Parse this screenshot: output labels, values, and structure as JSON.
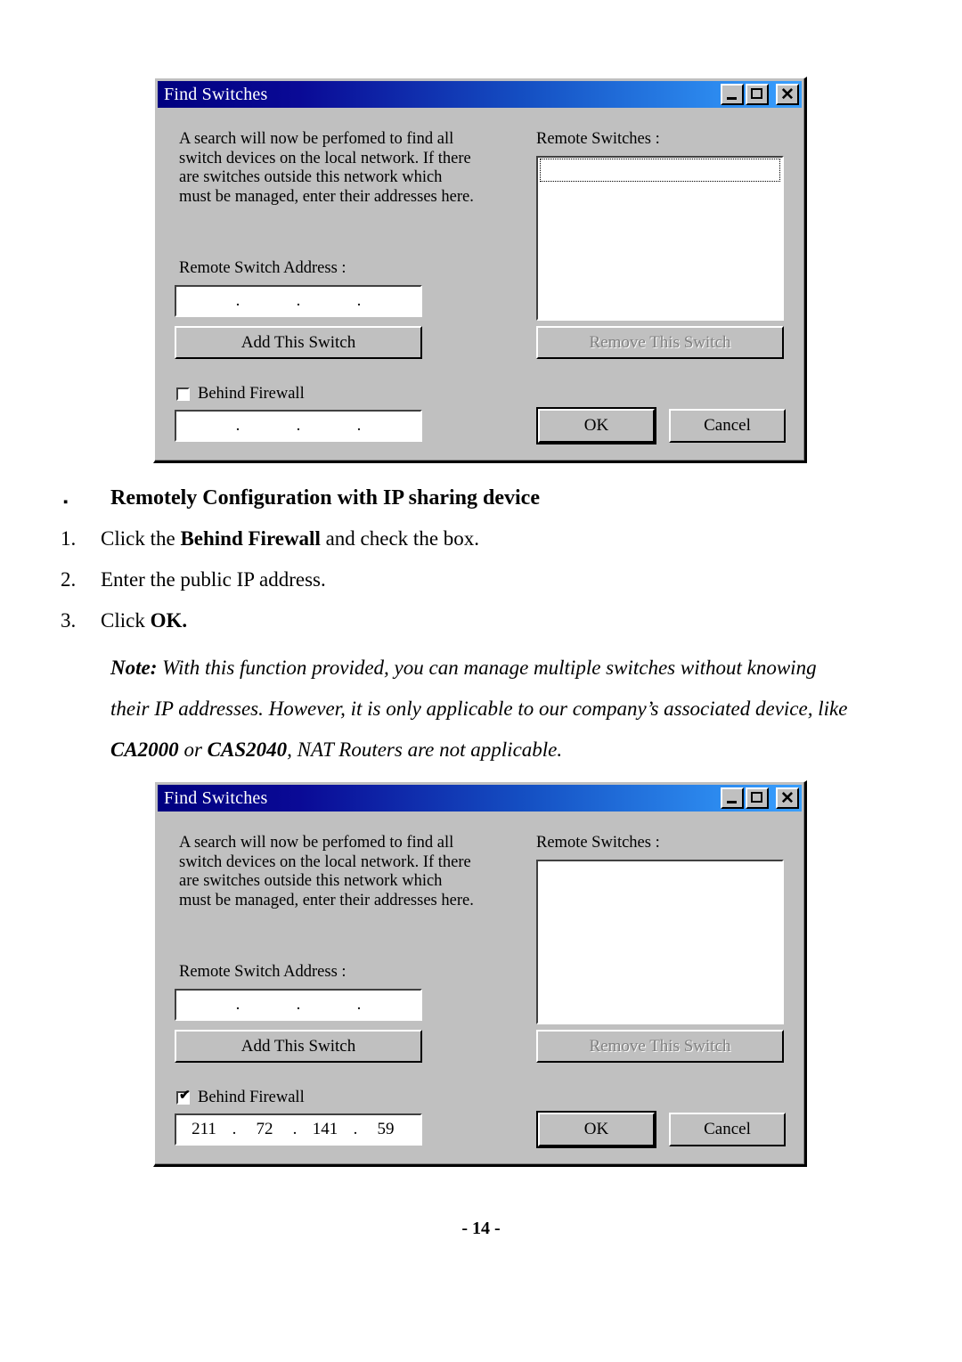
{
  "dialogs": [
    {
      "title": "Find Switches",
      "description": "A search will now be perfomed to find all\nswitch devices on the local network. If there\nare switches outside this network which\nmust be managed, enter their addresses here.",
      "remote_switches_label": "Remote Switches :",
      "remote_switch_address_label": "Remote Switch Address :",
      "address_octets": [
        "",
        "",
        "",
        ""
      ],
      "add_button": "Add This Switch",
      "remove_button": "Remove This Switch",
      "remove_disabled": true,
      "behind_firewall_label": "Behind Firewall",
      "behind_firewall_checked": false,
      "firewall_octets": [
        "",
        "",
        "",
        ""
      ],
      "ok_button": "OK",
      "cancel_button": "Cancel",
      "listbox_items": [],
      "listbox_focus": true,
      "window_controls": {
        "minimize": "minimize-icon",
        "maximize": "maximize-icon",
        "close": "✕"
      }
    },
    {
      "title": "Find Switches",
      "description": "A search will now be perfomed to find all\nswitch devices on the local network. If there\nare switches outside this network which\nmust be managed, enter their addresses here.",
      "remote_switches_label": "Remote Switches :",
      "remote_switch_address_label": "Remote Switch Address :",
      "address_octets": [
        "",
        "",
        "",
        ""
      ],
      "add_button": "Add This Switch",
      "remove_button": "Remove This Switch",
      "remove_disabled": true,
      "behind_firewall_label": "Behind Firewall",
      "behind_firewall_checked": true,
      "check_glyph": "✔",
      "firewall_octets": [
        "211",
        "72",
        "141",
        "59"
      ],
      "ok_button": "OK",
      "cancel_button": "Cancel",
      "listbox_items": [],
      "listbox_focus": false,
      "window_controls": {
        "minimize": "minimize-icon",
        "maximize": "maximize-icon",
        "close": "✕"
      }
    }
  ],
  "document": {
    "bullet_glyph": "▪",
    "section_heading": "Remotely Configuration with IP sharing device",
    "steps": [
      {
        "number": "1.",
        "pre": "Click the ",
        "bold": "Behind Firewall",
        "post": " and check the box."
      },
      {
        "number": "2.",
        "pre": "Enter the public IP address.",
        "bold": "",
        "post": ""
      },
      {
        "number": "3.",
        "pre": "Click ",
        "bold": "OK.",
        "post": ""
      }
    ],
    "note": {
      "label": "Note:",
      "part1": " With this function provided, you can manage multiple switches without knowing their IP addresses.    However, it is only applicable to our company’s associated device, like ",
      "device1": "CA2000",
      "mid": " or ",
      "device2": "CAS2040",
      "part2": ", NAT Routers are not applicable."
    },
    "page_number": "- 14 -"
  },
  "ip_separator": "."
}
